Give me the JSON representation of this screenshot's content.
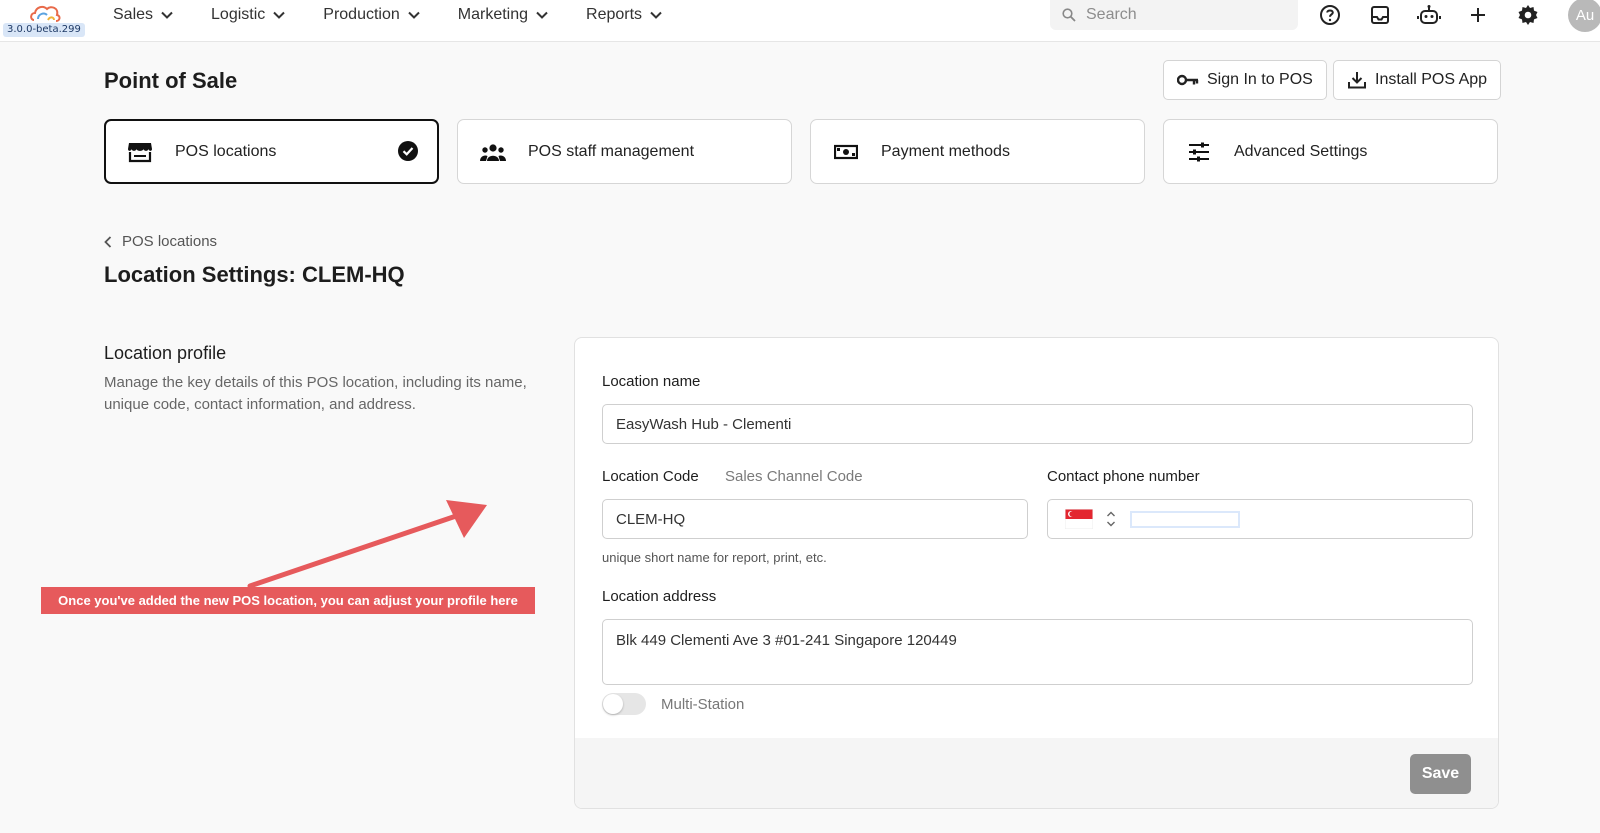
{
  "app": {
    "version": "3.0.0-beta.299",
    "avatar_initials": "Au"
  },
  "nav": {
    "items": [
      {
        "label": "Sales"
      },
      {
        "label": "Logistic"
      },
      {
        "label": "Production"
      },
      {
        "label": "Marketing"
      },
      {
        "label": "Reports"
      }
    ],
    "search_placeholder": "Search",
    "icons": [
      "help-circle-icon",
      "inbox-icon",
      "robot-icon",
      "plus-icon",
      "gear-icon"
    ]
  },
  "header": {
    "title": "Point of Sale",
    "sign_in_label": "Sign In to POS",
    "install_label": "Install POS App"
  },
  "tabs": [
    {
      "label": "POS locations",
      "icon": "store-icon",
      "active": true
    },
    {
      "label": "POS staff management",
      "icon": "users-icon",
      "active": false
    },
    {
      "label": "Payment methods",
      "icon": "cash-icon",
      "active": false
    },
    {
      "label": "Advanced Settings",
      "icon": "sliders-icon",
      "active": false
    }
  ],
  "breadcrumb": {
    "label": "POS locations"
  },
  "page": {
    "title": "Location Settings: CLEM-HQ"
  },
  "profile": {
    "title": "Location profile",
    "description": "Manage the key details of this POS location, including its name, unique code, contact information, and address."
  },
  "form": {
    "location_name_label": "Location name",
    "location_name_value": "EasyWash Hub - Clementi",
    "location_code_label": "Location Code",
    "sales_channel_code_label": "Sales Channel Code",
    "location_code_value": "CLEM-HQ",
    "location_code_hint": "unique short name for report, print, etc.",
    "phone_label": "Contact phone number",
    "address_label": "Location address",
    "address_value": "Blk 449 Clementi Ave 3 #01-241 Singapore 120449",
    "multi_station_label": "Multi-Station",
    "multi_station_enabled": false,
    "save_label": "Save"
  },
  "annotation": {
    "text": "Once you've added the new POS location, you can adjust your profile here",
    "color": "#e65a5c"
  }
}
